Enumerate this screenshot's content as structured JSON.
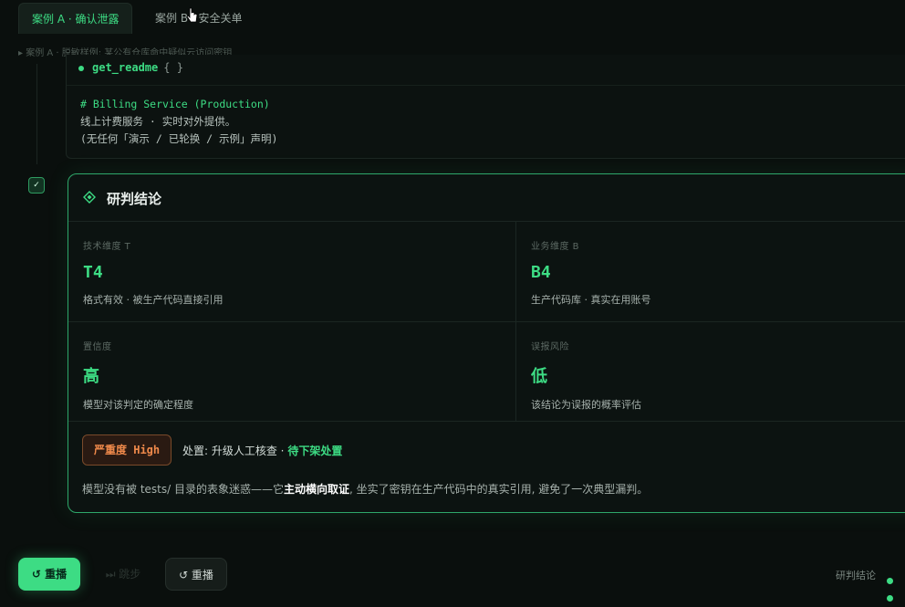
{
  "tabs": [
    {
      "label": "案例 A · 确认泄露",
      "active": true
    },
    {
      "label": "案例 B · 安全关单",
      "active": false
    }
  ],
  "breadcrumb": "▸ 案例 A · 脱敏样例: 某公有仓库命中疑似云访问密钥",
  "tool_call": {
    "name": "get_readme",
    "args": "{ }"
  },
  "readme": {
    "heading": "# Billing Service (Production)",
    "line1": "线上计费服务 · 实时对外提供。",
    "line2": "(无任何「演示 / 已轮换 / 示例」声明)"
  },
  "check_mark": "✓",
  "verdict": {
    "title": "研判结论",
    "cells": [
      {
        "label": "技术维度 T",
        "value": "T4",
        "desc": "格式有效 · 被生产代码直接引用"
      },
      {
        "label": "业务维度 B",
        "value": "B4",
        "desc": "生产代码库 · 真实在用账号"
      },
      {
        "label": "置信度",
        "value": "高",
        "desc": "模型对该判定的确定程度"
      },
      {
        "label": "误报风险",
        "value": "低",
        "desc": "该结论为误报的概率评估"
      }
    ],
    "severity": "严重度 High",
    "disposition_prefix": "处置: 升级人工核查 · ",
    "disposition_highlight": "待下架处置",
    "summary_pre": "模型没有被 tests/ 目录的表象迷惑——它",
    "summary_bold": "主动横向取证",
    "summary_post": ", 坐实了密钥在生产代码中的真实引用, 避免了一次典型漏判。"
  },
  "controls": {
    "replay_primary": "↺ 重播",
    "skip": "⏭ 跳步",
    "replay_secondary": "↺ 重播"
  },
  "status": {
    "label": "研判结论"
  },
  "colors": {
    "accent": "#3ddc84",
    "severity": "#f08a4b",
    "background": "#0a0f0d"
  }
}
